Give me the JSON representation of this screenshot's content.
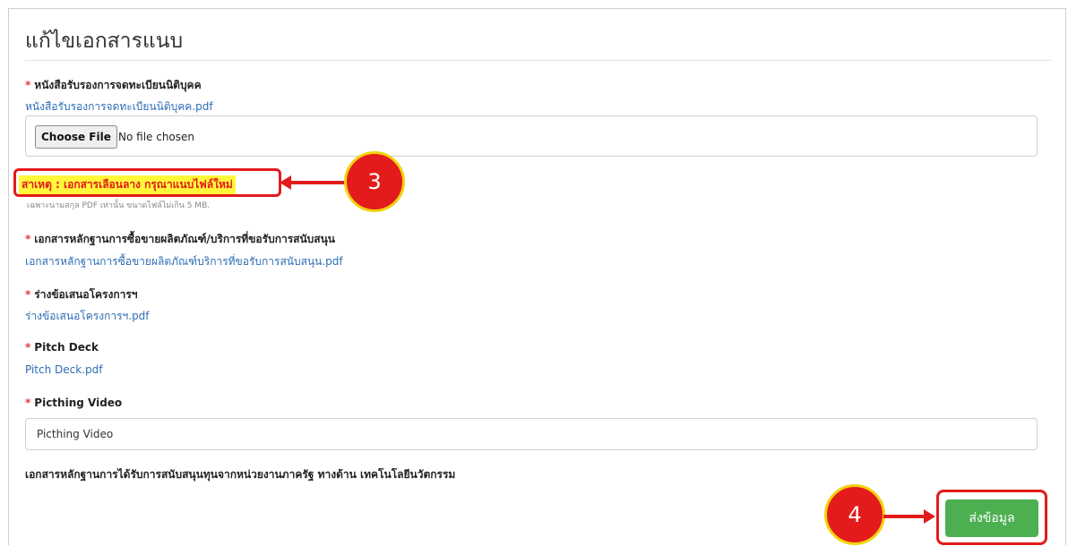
{
  "form": {
    "title": "แก้ไขเอกสารแนบ",
    "required_mark": "*",
    "field1": {
      "label": "หนังสือรับรองการจดทะเบียนนิติบุคค",
      "file_link": "หนังสือรับรองการจดทะเบียนนิติบุคค.pdf",
      "choose_file_label": "Choose File",
      "no_file_text": "No file chosen",
      "note": "สาเหตุ : เอกสารเลือนลาง กรุณาแนบไฟล์ใหม่",
      "hint": "เฉพาะนามสกุล PDF เท่านั้น ขนาดไฟล์ไม่เกิน 5 MB."
    },
    "field2": {
      "label": "เอกสารหลักฐานการซื้อขายผลิตภัณฑ์/บริการที่ขอรับการสนับสนุน",
      "file_link": "เอกสารหลักฐานการซื้อขายผลิตภัณฑ์บริการที่ขอรับการสนับสนุน.pdf"
    },
    "field3": {
      "label": "ร่างข้อเสนอโครงการฯ",
      "file_link": "ร่างข้อเสนอโครงการฯ.pdf"
    },
    "field4": {
      "label": "Pitch Deck",
      "file_link": "Pitch Deck.pdf"
    },
    "field5": {
      "label": "Picthing Video",
      "placeholder": "Picthing Video"
    },
    "field6": {
      "label": "เอกสารหลักฐานการได้รับการสนับสนุนทุนจากหน่วยงานภาครัฐ ทางด้าน เทคโนโลยีนวัตกรรม"
    },
    "submit_label": "ส่งข้อมูล"
  },
  "annotations": {
    "step3": "3",
    "step4": "4"
  },
  "colors": {
    "link": "#2d6db5",
    "annotation_red": "#e31b1b",
    "highlight_yellow": "#fff83a",
    "submit_green": "#4caf50"
  }
}
